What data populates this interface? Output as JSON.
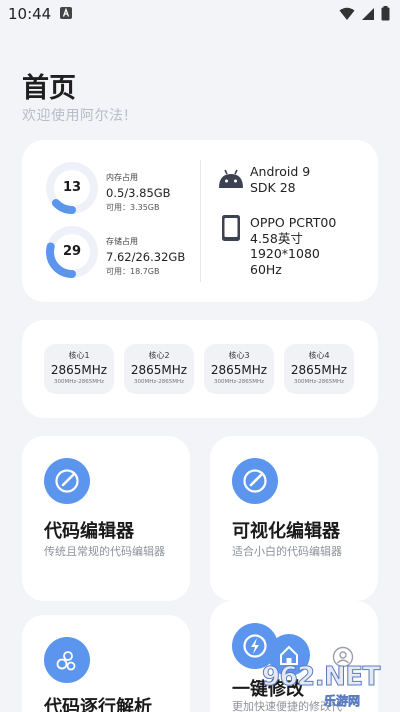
{
  "status": {
    "time": "10:44"
  },
  "header": {
    "title": "首页",
    "subtitle": "欢迎使用阿尔法!"
  },
  "memory": {
    "percent": "13",
    "fill": 0.13,
    "label": "内存占用",
    "value": "0.5/3.85GB",
    "available": "可用：3.35GB"
  },
  "storage": {
    "percent": "29",
    "fill": 0.29,
    "label": "存储占用",
    "value": "7.62/26.32GB",
    "available": "可用：18.7GB"
  },
  "device": {
    "android": "Android 9",
    "sdk": "SDK 28",
    "model": "OPPO PCRT00",
    "screen_size": "4.58英寸",
    "resolution": "1920*1080",
    "refresh": "60Hz"
  },
  "cores": [
    {
      "name": "核心1",
      "freq": "2865MHz",
      "range": "300MHz-2865MHz"
    },
    {
      "name": "核心2",
      "freq": "2865MHz",
      "range": "300MHz-2865MHz"
    },
    {
      "name": "核心3",
      "freq": "2865MHz",
      "range": "300MHz-2865MHz"
    },
    {
      "name": "核心4",
      "freq": "2865MHz",
      "range": "300MHz-2865MHz"
    }
  ],
  "features": [
    {
      "title": "代码编辑器",
      "desc": "传统且常规的代码编辑器",
      "icon": "pen-icon"
    },
    {
      "title": "可视化编辑器",
      "desc": "适合小白的代码编辑器",
      "icon": "pen-icon"
    },
    {
      "title": "代码逐行解析",
      "desc": "",
      "icon": "bubbles-icon"
    },
    {
      "title": "一键修改",
      "desc": "更加快速便捷的修改代",
      "icon": "bolt-icon"
    }
  ],
  "watermark": {
    "big": "962.NET",
    "small": "乐游网"
  },
  "colors": {
    "accent": "#5b95ee",
    "background": "#f3f4f8",
    "card": "#ffffff"
  }
}
